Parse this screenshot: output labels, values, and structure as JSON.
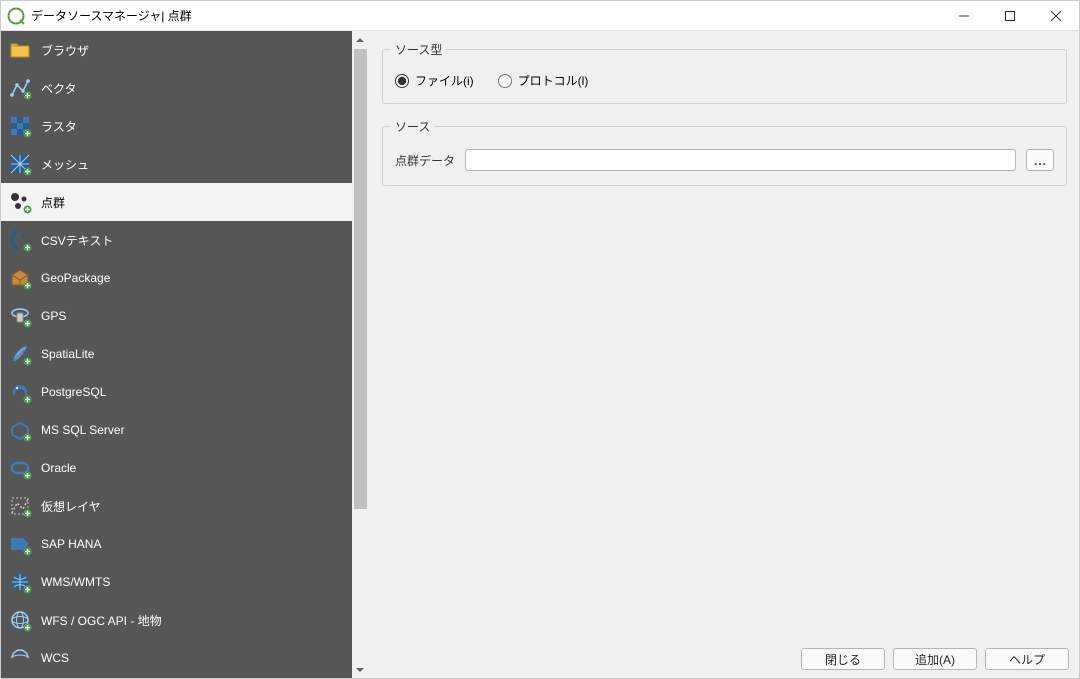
{
  "window": {
    "title": "データソースマネージャ| 点群"
  },
  "sidebar": {
    "items": [
      {
        "label": "ブラウザ"
      },
      {
        "label": "ベクタ"
      },
      {
        "label": "ラスタ"
      },
      {
        "label": "メッシュ"
      },
      {
        "label": "点群"
      },
      {
        "label": "CSVテキスト"
      },
      {
        "label": "GeoPackage"
      },
      {
        "label": "GPS"
      },
      {
        "label": "SpatiaLite"
      },
      {
        "label": "PostgreSQL"
      },
      {
        "label": "MS SQL Server"
      },
      {
        "label": "Oracle"
      },
      {
        "label": "仮想レイヤ"
      },
      {
        "label": "SAP HANA"
      },
      {
        "label": "WMS/WMTS"
      },
      {
        "label": "WFS / OGC API - 地物"
      },
      {
        "label": "WCS"
      }
    ],
    "selected_index": 4
  },
  "source_type": {
    "legend": "ソース型",
    "file": "ファイル(i)",
    "protocol": "プロトコル(l)",
    "selected": "file"
  },
  "source": {
    "legend": "ソース",
    "field_label": "点群データ",
    "value": "",
    "browse_label": "…"
  },
  "buttons": {
    "close": "閉じる",
    "add": "追加(A)",
    "help": "ヘルプ"
  }
}
